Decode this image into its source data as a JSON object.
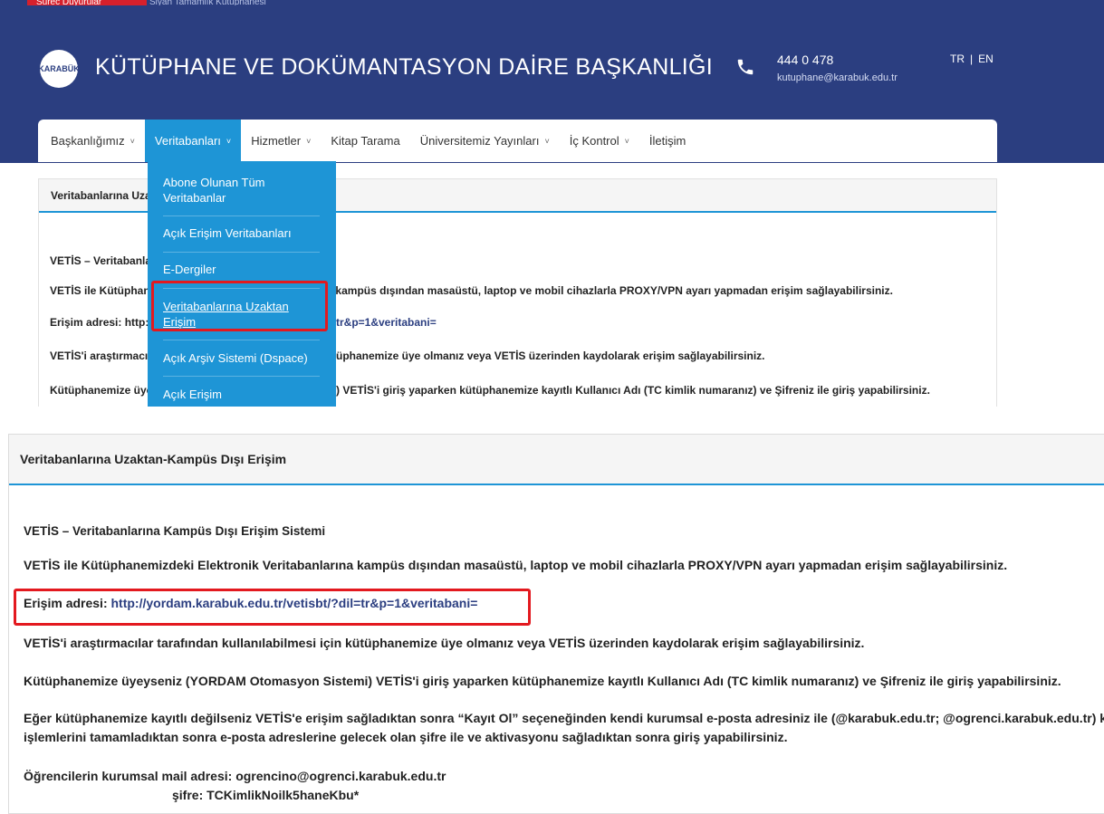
{
  "header": {
    "top_strip_left": "Sürec Duyurular",
    "top_strip_right": "Siyah Tamamlık Kütüphanesi",
    "logo_text": "KARABÜK",
    "site_title": "KÜTÜPHANE VE DOKÜMANTASYON DAİRE BAŞKANLIĞI",
    "phone": "444 0 478",
    "email": "kutuphane@karabuk.edu.tr",
    "lang_tr": "TR",
    "lang_sep": "|",
    "lang_en": "EN"
  },
  "nav": {
    "items": [
      {
        "label": "Başkanlığımız",
        "chevron": "˅"
      },
      {
        "label": "Veritabanları",
        "chevron": "˅"
      },
      {
        "label": "Hizmetler",
        "chevron": "˅"
      },
      {
        "label": "Kitap Tarama"
      },
      {
        "label": "Üniversitemiz Yayınları",
        "chevron": "˅"
      },
      {
        "label": "İç Kontrol",
        "chevron": "˅"
      },
      {
        "label": "İletişim"
      }
    ]
  },
  "dropdown": {
    "items": [
      {
        "label": "Abone Olunan Tüm Veritabanlar"
      },
      {
        "label": "Açık Erişim Veritabanları"
      },
      {
        "label": "E-Dergiler"
      },
      {
        "label": "Veritabanlarına Uzaktan Erişim"
      },
      {
        "label": "Açık Arşiv Sistemi (Dspace)"
      },
      {
        "label": "Açık Erişim"
      }
    ]
  },
  "top_page": {
    "box_title": "Veritabanlarına Uzaktan-Kampüs Dışı Erişim",
    "line_system_partial": "VETİS – Veritabanlarına Kampüs Dışı Erişim Sistemi",
    "line_vetis_left": "VETİS ile Kütüphanemizdeki Elektronik Veritabanlarına kampüs dışından masaüstü, laptop ve mobil cihazlarla PROXY/VPN ayarı yapmadan erişim sağlayabilirsiniz.",
    "line_vetis_right": "kampüs dışından masaüstü, laptop ve mobil cihazlarla PROXY/VPN ayarı yapmadan erişim sağlayabilirsiniz.",
    "line_addr_left": "Erişim adresi: http://",
    "line_addr_right": "tr&p=1&veritabani=",
    "line_research_left": "VETİS'i araştırmacıl",
    "line_research_right": "üphanemize üye olmanız veya VETİS üzerinden kaydolarak erişim sağlayabilirsiniz.",
    "line_member_left": "Kütüphanemize üye",
    "line_member_right": ") VETİS'i giriş yaparken kütüphanemize kayıtlı Kullanıcı Adı (TC kimlik numaranız) ve Şifreniz ile giriş yapabilirsiniz."
  },
  "bottom_page": {
    "box_title": "Veritabanlarına Uzaktan-Kampüs Dışı Erişim",
    "system_title": "VETİS – Veritabanlarına Kampüs Dışı Erişim Sistemi",
    "intro": "VETİS ile Kütüphanemizdeki Elektronik Veritabanlarına kampüs dışından masaüstü, laptop ve mobil cihazlarla PROXY/VPN ayarı yapmadan erişim sağlayabilirsiniz.",
    "address_label": "Erişim adresi: ",
    "address_url": "http://yordam.karabuk.edu.tr/vetisbt/?dil=tr&p=1&veritabani=",
    "research": "VETİS'i araştırmacılar tarafından kullanılabilmesi için kütüphanemize üye olmanız veya VETİS üzerinden kaydolarak erişim sağlayabilirsiniz.",
    "member": "Kütüphanemize üyeyseniz (YORDAM Otomasyon Sistemi) VETİS'i giriş yaparken kütüphanemize kayıtlı Kullanıcı Adı (TC kimlik numaranız) ve Şifreniz ile giriş yapabilirsiniz.",
    "register_1": "Eğer kütüphanemize kayıtlı değilseniz VETİS'e erişim sağladıktan sonra “Kayıt Ol” seçeneğinden kendi kurumsal e-posta adresiniz ile (@karabuk.edu.tr; @ogrenci.karabuk.edu.tr) kayıt",
    "register_2": "işlemlerini tamamladıktan sonra e-posta adreslerine gelecek olan şifre ile ve aktivasyonu sağladıktan sonra giriş yapabilirsiniz.",
    "student_mail": "Öğrencilerin kurumsal mail adresi: ogrencino@ogrenci.karabuk.edu.tr",
    "password_label": "şifre: ",
    "password_value": "TCKimlikNoilk5haneKbu*"
  },
  "colors": {
    "header_bg": "#2b3e80",
    "accent": "#1e95d6",
    "highlight": "#e3191f",
    "link": "#2b3e80"
  }
}
